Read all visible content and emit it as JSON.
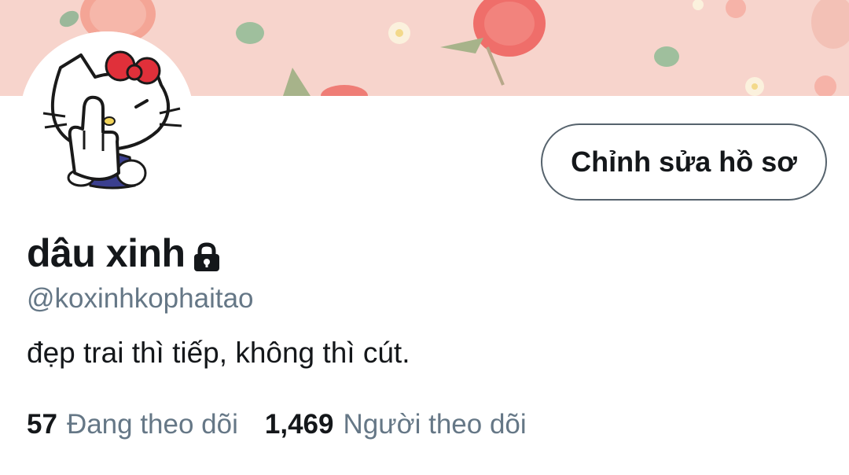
{
  "profile": {
    "display_name": "dâu xinh",
    "handle": "@koxinhkophaitao",
    "bio": "đẹp trai thì tiếp, không thì cút.",
    "locked_icon": "lock-icon",
    "avatar": "hello-kitty-avatar",
    "banner": "strawberry-pattern-banner"
  },
  "actions": {
    "edit_profile_label": "Chỉnh sửa hồ sơ"
  },
  "stats": {
    "following_count": "57",
    "following_label": "Đang theo dõi",
    "followers_count": "1,469",
    "followers_label": "Người theo dõi"
  },
  "colors": {
    "banner_bg": "#f7d4cc",
    "text_primary": "#14171a",
    "text_secondary": "#657786",
    "button_border": "#56636d"
  }
}
